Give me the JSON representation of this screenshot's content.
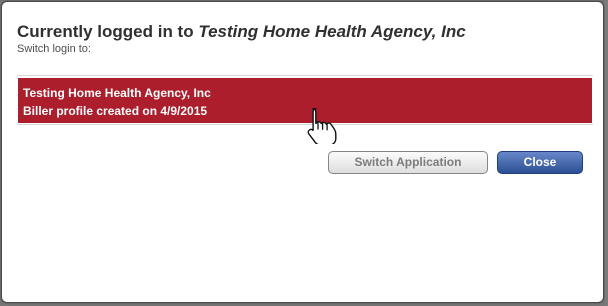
{
  "dialog": {
    "title_prefix": "Currently logged in to ",
    "title_org": "Testing Home Health Agency, Inc",
    "subtitle": "Switch login to:"
  },
  "accounts": [
    {
      "name": "Testing Home Health Agency, Inc",
      "detail": "Biller profile created on 4/9/2015"
    }
  ],
  "actions": {
    "switch_label": "Switch Application",
    "close_label": "Close"
  },
  "colors": {
    "selected_row": "#ad1e2d",
    "primary_button": "#2c4f94"
  },
  "icons": {
    "cursor": "hand-pointer-icon"
  }
}
